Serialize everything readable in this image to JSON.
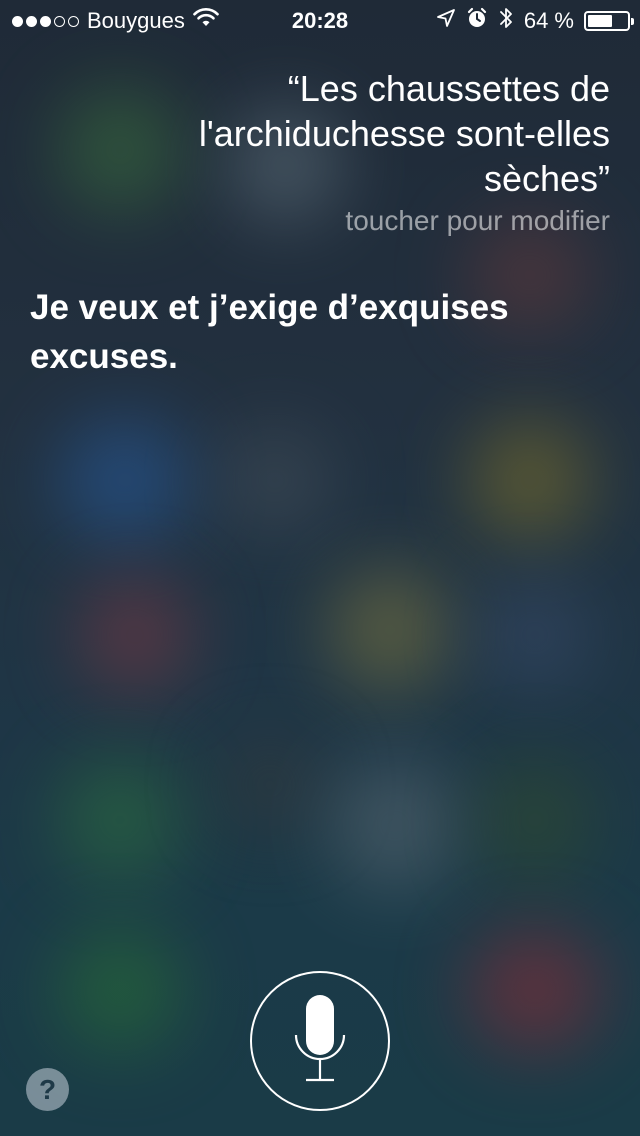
{
  "status_bar": {
    "carrier": "Bouygues",
    "signal_bars_filled": 3,
    "signal_bars_total": 5,
    "time": "20:28",
    "battery": "64 %",
    "battery_level": 0.64,
    "icons": [
      "wifi-icon",
      "location-arrow-icon",
      "alarm-icon",
      "bluetooth-icon",
      "battery-icon"
    ]
  },
  "siri": {
    "query_lines": [
      "“Les chaussettes de",
      "l'archiduchesse sont-elles",
      "sèches”"
    ],
    "edit_hint": "toucher pour modifier",
    "response_lines": [
      "Je veux et j’exige d’exquises",
      "excuses."
    ]
  },
  "controls": {
    "mic_icon": "microphone-icon",
    "help_label": "?"
  },
  "colors": {
    "text": "#ffffff",
    "hint_text": "rgba(255,255,255,0.55)",
    "help_bg": "#8a9aa6"
  }
}
